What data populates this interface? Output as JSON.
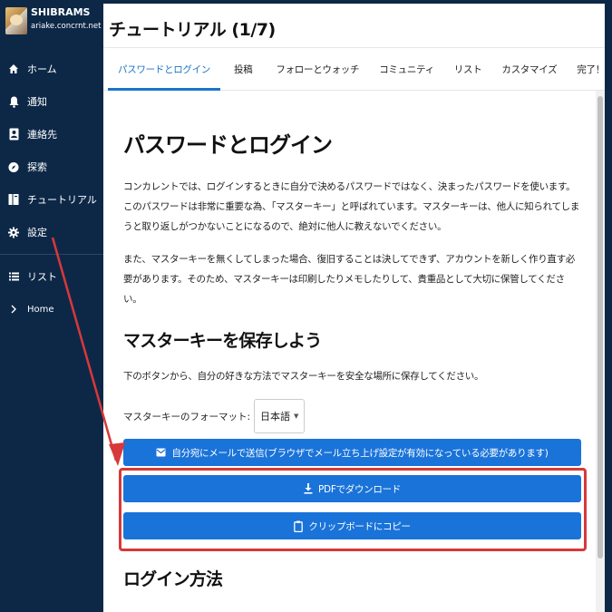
{
  "profile": {
    "name": "SHIBRAMS",
    "host": "ariake.concrnt.net"
  },
  "sidebar": {
    "items": [
      {
        "label": "ホーム",
        "icon": "home-icon"
      },
      {
        "label": "通知",
        "icon": "bell-icon"
      },
      {
        "label": "連絡先",
        "icon": "contacts-icon"
      },
      {
        "label": "探索",
        "icon": "explore-icon"
      },
      {
        "label": "チュートリアル",
        "icon": "book-icon"
      },
      {
        "label": "設定",
        "icon": "gear-icon"
      }
    ],
    "lists": [
      {
        "label": "リスト",
        "icon": "list-icon"
      },
      {
        "label": "Home",
        "icon": "chevron-right-icon"
      }
    ]
  },
  "panel": {
    "title": "チュートリアル (1/7)"
  },
  "tabs": [
    "パスワードとログイン",
    "投稿",
    "フォローとウォッチ",
    "コミュニティ",
    "リスト",
    "カスタマイズ",
    "完了！"
  ],
  "content": {
    "heading": "パスワードとログイン",
    "para1": "コンカレントでは、ログインするときに自分で決めるパスワードではなく、決まったパスワードを使います。このパスワードは非常に重要な為、「マスターキー」と呼ばれています。マスターキーは、他人に知られてしまうと取り返しがつかないことになるので、絶対に他人に教えないでください。",
    "para2": "また、マスターキーを無くしてしまった場合、復旧することは決してできず、アカウントを新しく作り直す必要があります。そのため、マスターキーは印刷したりメモしたりして、貴重品として大切に保管してください。",
    "save_heading": "マスターキーを保存しよう",
    "save_desc": "下のボタンから、自分の好きな方法でマスターキーを安全な場所に保存してください。",
    "format_label": "マスターキーのフォーマット:",
    "format_value": "日本語",
    "btn_email": "自分宛にメールで送信(ブラウザでメール立ち上げ設定が有効になっている必要があります)",
    "btn_pdf": "PDFでダウンロード",
    "btn_copy": "クリップボードにコピー",
    "login_heading": "ログイン方法"
  },
  "colors": {
    "sidebar_bg": "#0d2847",
    "accent": "#1a73d9",
    "highlight": "#d8383a"
  }
}
